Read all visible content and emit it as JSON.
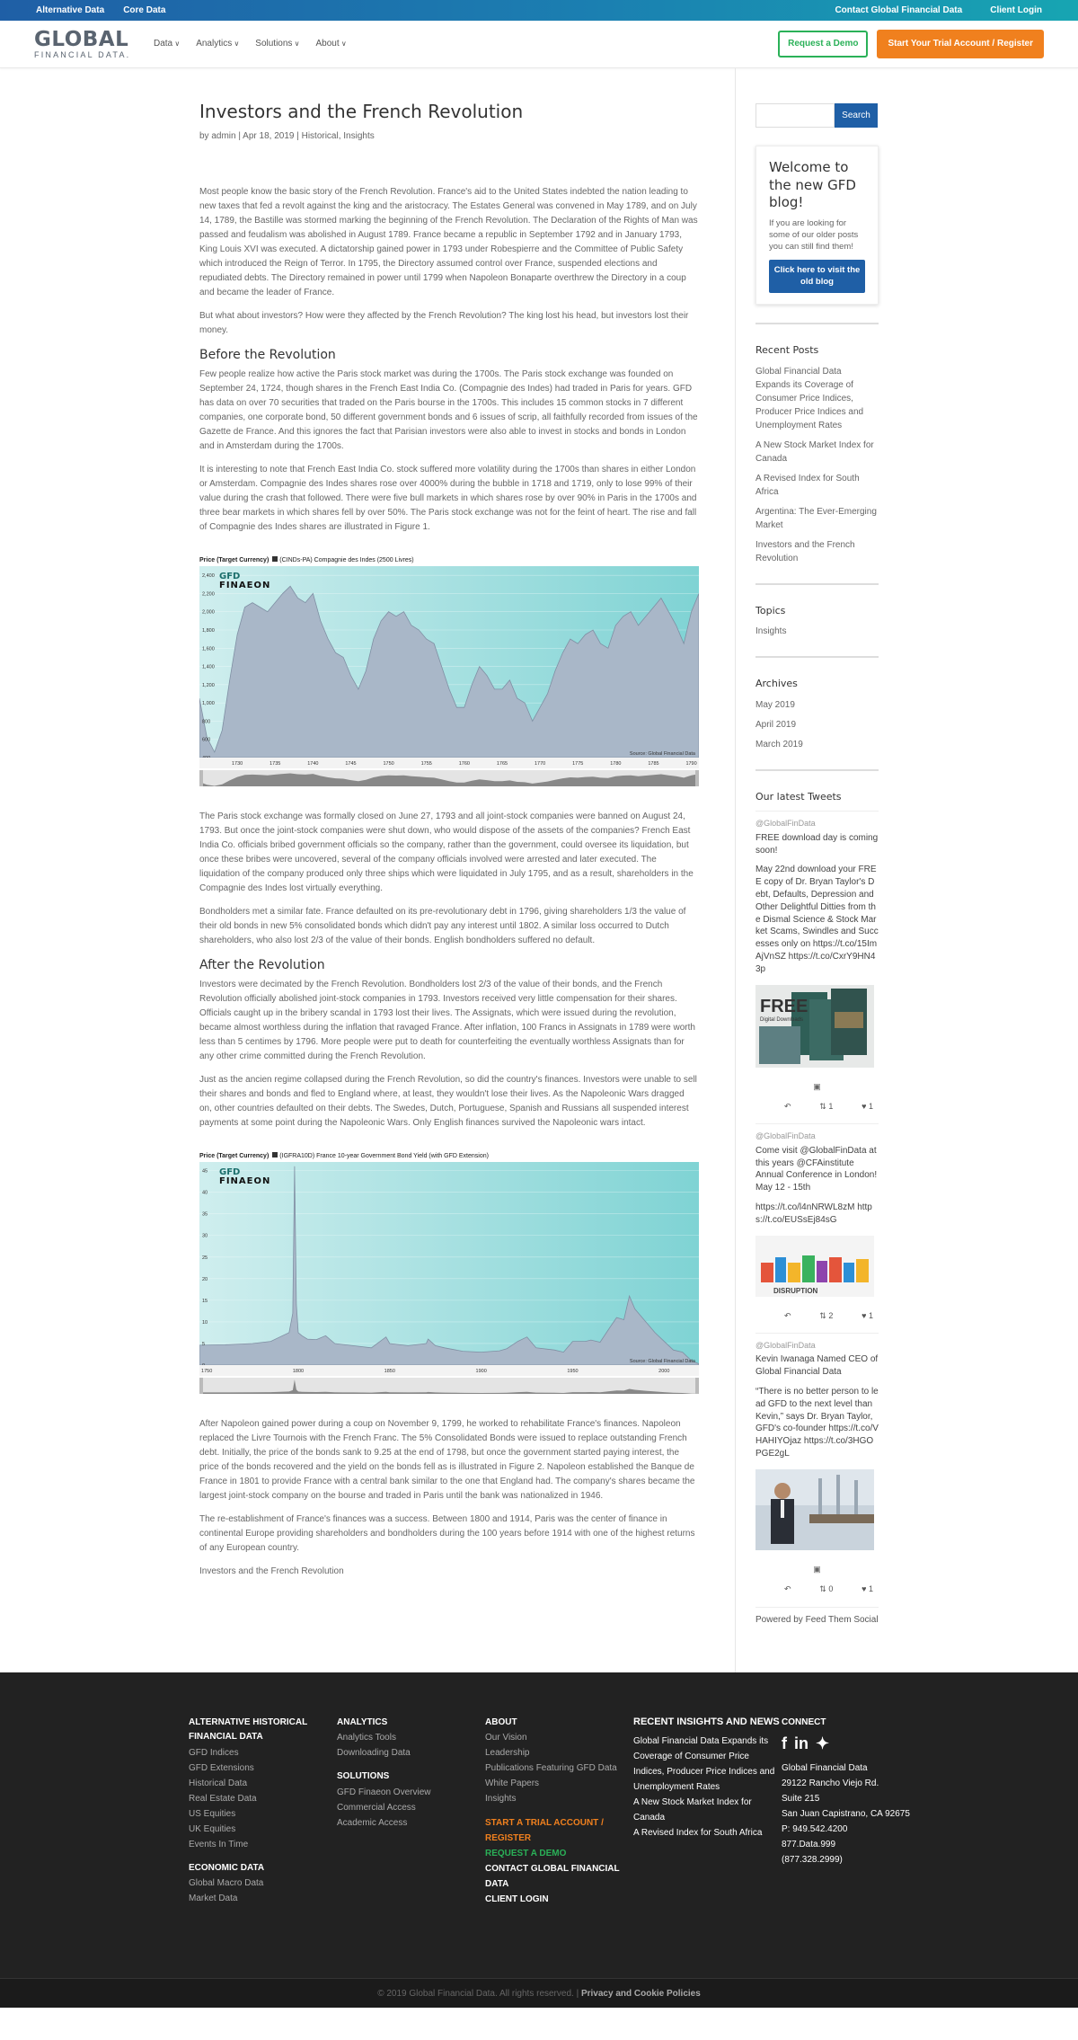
{
  "topbar": {
    "left": [
      "Alternative Data",
      "Core Data"
    ],
    "right": [
      "Contact Global Financial Data",
      "Client Login"
    ]
  },
  "header": {
    "logo_line1": "GLOBAL",
    "logo_line2": "FINANCIAL DATA.",
    "nav": [
      "Data",
      "Analytics",
      "Solutions",
      "About"
    ],
    "demo_button": "Request a Demo",
    "trial_button": "Start Your Trial Account / Register"
  },
  "article": {
    "title": "Investors and the French Revolution",
    "meta": "by admin | Apr 18, 2019 | Historical, Insights",
    "p1": "Most people know the basic story of the French Revolution.  France's aid to the United States indebted the nation leading to new taxes that fed a revolt against the king and the aristocracy. The Estates General was convened in May 1789, and on July 14, 1789, the Bastille was stormed marking the beginning of the French Revolution. The Declaration of the Rights of Man was passed and feudalism was abolished in August 1789. France became a republic in September 1792 and in January 1793, King Louis XVI was executed. A dictatorship gained power in 1793 under Robespierre and the Committee of Public Safety which introduced the Reign of Terror. In 1795, the Directory assumed control over France, suspended elections and repudiated debts. The Directory remained in power until 1799 when Napoleon Bonaparte overthrew the Directory in a coup and became the leader of France.",
    "p2": "But what about investors?  How were they affected by the French Revolution? The king lost his head, but investors lost their money.",
    "h_before": "Before the Revolution",
    "p3": "Few people realize how active the Paris stock market was during the 1700s. The Paris stock exchange was founded on September 24, 1724, though shares in the French East India Co. (Compagnie des Indes) had traded in Paris for years.   GFD has data on over 70 securities that traded on the Paris bourse in the 1700s.  This includes 15 common stocks in 7 different companies, one corporate bond, 50 different government bonds and 6 issues of scrip, all faithfully recorded from issues of the Gazette de France. And this ignores the fact that Parisian investors were also able to invest in stocks and bonds in London and in Amsterdam during the 1700s.",
    "p4": "It is interesting to note that French East India Co. stock suffered more volatility during the 1700s than shares in either London or Amsterdam.  Compagnie des Indes shares rose over 4000% during the bubble in 1718 and 1719, only to lose 99% of their value during the crash that followed. There were five bull markets in which shares rose by over 90% in Paris in the 1700s and three bear markets in which shares fell by over 50%.  The Paris stock exchange was not for the feint of heart.  The rise and fall of Compagnie des Indes shares are illustrated in Figure 1.",
    "p5": "The Paris stock exchange was formally closed on June 27, 1793 and all joint-stock companies were banned on August 24, 1793. But once the joint-stock companies were shut down, who would dispose of the assets of the companies? French East India Co. officials bribed government officials so the company, rather than the government, could oversee its liquidation, but once these bribes were uncovered, several of the company officials involved were arrested and later executed. The liquidation of the company produced only three ships which were liquidated in July 1795, and as a result, shareholders in the Compagnie des Indes lost virtually everything.",
    "p6": "Bondholders met a similar fate. France defaulted on its pre-revolutionary debt in 1796, giving shareholders 1/3 the value of their old bonds in new 5% consolidated bonds which didn't pay any interest until 1802.   A similar loss occurred to Dutch shareholders, who also lost 2/3 of the value of their bonds.  English bondholders suffered no default.",
    "h_after": "After the Revolution",
    "p7": "Investors were decimated by the French Revolution.  Bondholders lost 2/3 of the value of their bonds, and the French Revolution officially abolished joint-stock companies in 1793.  Investors received very little compensation for their shares. Officials caught up in the bribery scandal in 1793 lost their lives. The Assignats, which were issued during the revolution, became almost worthless during the inflation that ravaged France.  After inflation, 100 Francs in Assignats in 1789 were worth less than 5 centimes by 1796. More people were put to death for counterfeiting the eventually worthless Assignats than for any other crime committed during the French Revolution.",
    "p8": "Just as the ancien regime collapsed during the French Revolution, so did the country's finances.  Investors were unable to sell their shares and bonds and fled to England where, at least, they wouldn't lose their lives. As the Napoleonic Wars dragged on, other countries defaulted on their debts. The Swedes, Dutch, Portuguese, Spanish and Russians all suspended interest payments at some point during the Napoleonic Wars.  Only English finances survived the Napoleonic wars intact.",
    "p9": "After Napoleon gained power during a coup on November 9, 1799, he worked to rehabilitate France's finances. Napoleon replaced the Livre Tournois with the French Franc.  The 5% Consolidated Bonds were issued to replace outstanding French debt. Initially, the price of the bonds sank to 9.25 at the end of 1798, but once the government started paying interest, the price of the bonds recovered and the yield on the bonds fell as is illustrated in Figure 2.  Napoleon established the Banque de France in 1801 to provide France with a central bank similar to the one that England had.  The company's shares became the largest joint-stock company on the bourse and traded in Paris until the bank was nationalized in 1946.",
    "p10": "The re-establishment of France's finances was a success. Between 1800 and 1914, Paris was the center of finance in continental Europe providing shareholders and bondholders during the 100 years before 1914 with one of the highest returns of any European country.",
    "p11": "Investors and the French Revolution"
  },
  "chart_data": [
    {
      "type": "area",
      "title": "",
      "header_label": "Price (Target Currency)",
      "series_label": "(CINDs-PA) Compagnie des Indes (2500 Livres)",
      "watermark": [
        "GFD",
        "FINAEON"
      ],
      "source": "Source: Global Financial Data",
      "x_tick_labels": [
        "1730",
        "1735",
        "1740",
        "1745",
        "1750",
        "1755",
        "1760",
        "1765",
        "1770",
        "1775",
        "1780",
        "1785",
        "1790"
      ],
      "y_tick_labels": [
        "400",
        "600",
        "800",
        "1,000",
        "1,200",
        "1,400",
        "1,600",
        "1,800",
        "2,000",
        "2,200",
        "2,400"
      ],
      "ylim": [
        400,
        2500
      ],
      "xlim": [
        1725,
        1791
      ],
      "x": [
        1725,
        1726,
        1727,
        1728,
        1729,
        1730,
        1731,
        1732,
        1733,
        1734,
        1735,
        1736,
        1737,
        1738,
        1739,
        1740,
        1741,
        1742,
        1743,
        1744,
        1745,
        1746,
        1747,
        1748,
        1749,
        1750,
        1751,
        1752,
        1753,
        1754,
        1755,
        1756,
        1757,
        1758,
        1759,
        1760,
        1761,
        1762,
        1763,
        1764,
        1765,
        1766,
        1767,
        1768,
        1769,
        1770,
        1771,
        1772,
        1773,
        1774,
        1775,
        1776,
        1777,
        1778,
        1779,
        1780,
        1781,
        1782,
        1783,
        1784,
        1785,
        1786,
        1787,
        1788,
        1789,
        1790,
        1791
      ],
      "values": [
        1050,
        620,
        460,
        700,
        1250,
        1750,
        2050,
        2100,
        2050,
        2000,
        2100,
        2200,
        2280,
        2150,
        2100,
        2200,
        1900,
        1700,
        1550,
        1500,
        1300,
        1150,
        1350,
        1700,
        1900,
        2000,
        1950,
        2000,
        1850,
        1800,
        1700,
        1650,
        1400,
        1150,
        950,
        950,
        1200,
        1400,
        1300,
        1150,
        1150,
        1250,
        1050,
        1000,
        800,
        950,
        1100,
        1350,
        1550,
        1700,
        1650,
        1750,
        1800,
        1650,
        1600,
        1850,
        1950,
        2000,
        1850,
        1950,
        2050,
        2150,
        2000,
        1850,
        1650,
        2000,
        2200
      ]
    },
    {
      "type": "area",
      "title": "",
      "header_label": "Price (Target Currency)",
      "series_label": "(IGFRA10D) France 10-year Government Bond Yield (with GFD Extension)",
      "watermark": [
        "GFD",
        "FINAEON"
      ],
      "source": "Source: Global Financial Data",
      "x_tick_labels": [
        "1750",
        "1800",
        "1850",
        "1900",
        "1950",
        "2000"
      ],
      "y_tick_labels": [
        "0",
        "5",
        "10",
        "15",
        "20",
        "25",
        "30",
        "35",
        "40",
        "45"
      ],
      "ylim": [
        0,
        47
      ],
      "xlim": [
        1746,
        2019
      ],
      "x": [
        1746,
        1760,
        1775,
        1785,
        1790,
        1795,
        1797,
        1798,
        1799,
        1800,
        1802,
        1805,
        1810,
        1815,
        1820,
        1830,
        1840,
        1848,
        1850,
        1860,
        1870,
        1871,
        1875,
        1880,
        1890,
        1900,
        1910,
        1914,
        1920,
        1925,
        1930,
        1940,
        1945,
        1950,
        1957,
        1960,
        1965,
        1970,
        1974,
        1978,
        1981,
        1984,
        1990,
        1995,
        2000,
        2005,
        2010,
        2015,
        2019
      ],
      "values": [
        4.6,
        4.7,
        5.0,
        5.5,
        6.5,
        7.5,
        12.0,
        46.0,
        14.0,
        7.5,
        6.8,
        6.0,
        5.9,
        6.8,
        5.0,
        4.5,
        4.0,
        6.5,
        5.0,
        4.5,
        5.0,
        6.0,
        4.5,
        4.0,
        3.2,
        3.0,
        3.3,
        3.8,
        5.5,
        6.5,
        4.0,
        3.5,
        3.0,
        5.5,
        5.5,
        5.8,
        5.3,
        8.5,
        11.0,
        10.5,
        16.0,
        13.0,
        10.0,
        7.5,
        5.5,
        3.5,
        3.0,
        1.0,
        0.3
      ]
    }
  ],
  "sidebar": {
    "search_button": "Search",
    "welcome_title": "Welcome to the new GFD blog!",
    "welcome_text": "If you are looking for some of our older posts you can still find them!",
    "welcome_button": "Click here to visit the old blog",
    "recent_title": "Recent Posts",
    "recent": [
      "Global Financial Data Expands its Coverage of Consumer Price Indices, Producer Price Indices and Unemployment Rates",
      "A New Stock Market Index for Canada",
      "A Revised Index for South Africa",
      "Argentina: The Ever-Emerging Market",
      "Investors and the French Revolution"
    ],
    "topics_title": "Topics",
    "topics": [
      "Insights"
    ],
    "archives_title": "Archives",
    "archives": [
      "May 2019",
      "April 2019",
      "March 2019"
    ],
    "tweets_title": "Our latest Tweets",
    "tweets": [
      {
        "handle": "@GlobalFinData",
        "text1": "FREE download day is coming soon!",
        "text2": "May 22nd download your FREE copy of Dr. Bryan Taylor's Debt, Defaults, Depression and Other Delightful Ditties from the Dismal Science & Stock Market Scams, Swindles and Successes only on https://t.co/15ImAjVnSZ https://t.co/CxrY9HN43p",
        "img_text": "FREE",
        "img_sub": "Digital Downloads",
        "retweets": "1",
        "likes": "1"
      },
      {
        "handle": "@GlobalFinData",
        "text1": "Come visit @GlobalFinData at this years @CFAinstitute Annual Conference in London! May 12 - 15th",
        "text2": "https://t.co/l4nNRWL8zM https://t.co/EUSsEj84sG",
        "img_text": "DISRUPTION",
        "retweets": "2",
        "likes": "1"
      },
      {
        "handle": "@GlobalFinData",
        "text1": "Kevin Iwanaga Named CEO of Global Financial Data",
        "text2": "“There is no better person to lead GFD to the next level than Kevin,” says Dr. Bryan Taylor, GFD's co-founder https://t.co/VHAHIYOjaz https://t.co/3HGOPGE2gL",
        "retweets": "0",
        "likes": "1"
      }
    ],
    "powered": "Powered by Feed Them Social"
  },
  "footer": {
    "col1_h1": "ALTERNATIVE HISTORICAL FINANCIAL DATA",
    "col1_links": [
      "GFD Indices",
      "GFD Extensions",
      "Historical Data",
      "Real Estate Data",
      "US Equities",
      "UK Equities",
      "Events In Time"
    ],
    "col1_h2": "ECONOMIC DATA",
    "col1_links2": [
      "Global Macro Data",
      "Market Data"
    ],
    "col2_h1": "ANALYTICS",
    "col2_links": [
      "Analytics Tools",
      "Downloading Data"
    ],
    "col2_h2": "SOLUTIONS",
    "col2_links2": [
      "GFD Finaeon Overview",
      "Commercial Access",
      "Academic Access"
    ],
    "col3_h1": "ABOUT",
    "col3_links": [
      "Our Vision",
      "Leadership",
      "Publications Featuring GFD Data",
      "White Papers",
      "Insights"
    ],
    "col3_orange": "START A TRIAL ACCOUNT / REGISTER",
    "col3_green": "REQUEST A DEMO",
    "col3_white1": "CONTACT GLOBAL FINANCIAL DATA",
    "col3_white2": "CLIENT LOGIN",
    "col4_h": "RECENT INSIGHTS AND NEWS",
    "col4_links": [
      "Global Financial Data Expands its Coverage of Consumer Price Indices, Producer Price Indices and Unemployment Rates",
      "A New Stock Market Index for Canada",
      "A Revised Index for South Africa"
    ],
    "col5_h": "CONNECT",
    "col5_lines": [
      "Global Financial Data",
      "29122 Rancho Viejo Rd.",
      "Suite 215",
      "San Juan Capistrano, CA 92675",
      "P: 949.542.4200",
      "877.Data.999",
      "(877.328.2999)"
    ],
    "copyright": "© 2019 Global Financial Data. All rights reserved. |",
    "privacy": "Privacy and Cookie Policies"
  },
  "colors": {
    "brand_blue": "#1f5fa6",
    "teal": "#17a5b2",
    "orange": "#f0801e",
    "green": "#2ab158"
  }
}
